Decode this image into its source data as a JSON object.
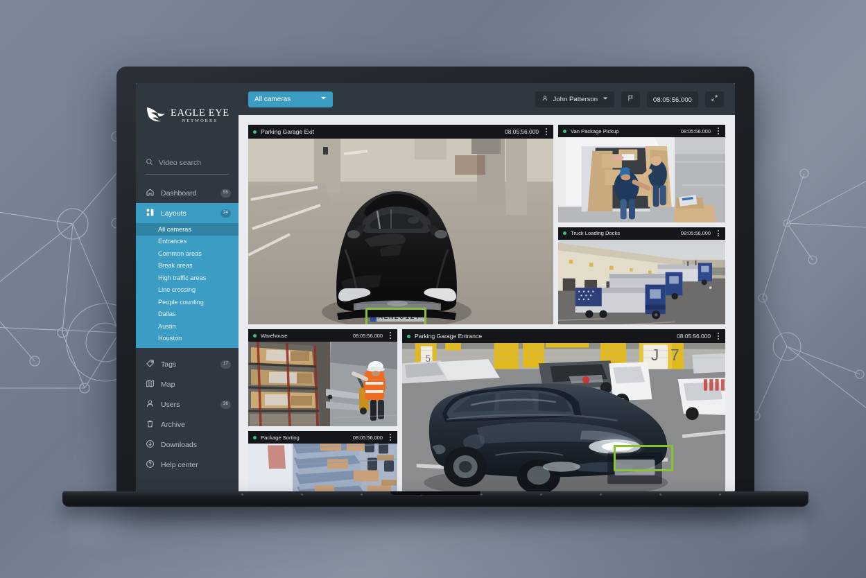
{
  "brand": {
    "name_line1": "EAGLE EYE",
    "name_line2": "NETWORKS",
    "accent": "#3b9cc4",
    "sidebar_bg": "#2f3741",
    "detection_box_color": "#86c232",
    "status_dot_color": "#3fc07f"
  },
  "sidebar": {
    "search": {
      "placeholder": "Video search",
      "value": "",
      "icon": "search-icon"
    },
    "items": [
      {
        "label": "Dashboard",
        "badge": "55",
        "icon": "home-icon",
        "active": false
      },
      {
        "label": "Layouts",
        "badge": "24",
        "icon": "layouts-grid-icon",
        "active": true
      },
      {
        "label": "Tags",
        "badge": "17",
        "icon": "tag-icon",
        "active": false
      },
      {
        "label": "Map",
        "badge": "",
        "icon": "map-icon",
        "active": false
      },
      {
        "label": "Users",
        "badge": "36",
        "icon": "user-icon",
        "active": false
      },
      {
        "label": "Archive",
        "badge": "",
        "icon": "trash-icon",
        "active": false
      },
      {
        "label": "Downloads",
        "badge": "",
        "icon": "download-circle-icon",
        "active": false
      },
      {
        "label": "Help center",
        "badge": "",
        "icon": "help-circle-icon",
        "active": false
      }
    ],
    "layouts_submenu": [
      {
        "label": "All cameras",
        "selected": true
      },
      {
        "label": "Entrances",
        "selected": false
      },
      {
        "label": "Common areas",
        "selected": false
      },
      {
        "label": "Break areas",
        "selected": false
      },
      {
        "label": "High traffic areas",
        "selected": false
      },
      {
        "label": "Line crossing",
        "selected": false
      },
      {
        "label": "People counting",
        "selected": false
      },
      {
        "label": "Dallas",
        "selected": false
      },
      {
        "label": "Austin",
        "selected": false
      },
      {
        "label": "Houston",
        "selected": false
      }
    ]
  },
  "topbar": {
    "camera_filter": {
      "label": "All cameras",
      "icon": "chevron-down-icon"
    },
    "user": {
      "label": "John Patterson",
      "icon": "user-icon",
      "chevron": "chevron-down-icon"
    },
    "flag_button": {
      "icon": "flag-icon"
    },
    "timestamp": "08:05:56.000",
    "fullscreen_button": {
      "icon": "expand-arrows-icon"
    }
  },
  "tiles": [
    {
      "title": "Parking Garage Exit",
      "time": "08:05:56.000",
      "status": "online",
      "scene": "garage-exit"
    },
    {
      "title": "Van Package Pickup",
      "time": "08:05:56.000",
      "status": "online",
      "scene": "van"
    },
    {
      "title": "Truck Loading Docks",
      "time": "08:05:56.000",
      "status": "online",
      "scene": "trucks"
    },
    {
      "title": "Warehouse",
      "time": "08:05:56.000",
      "status": "online",
      "scene": "warehouse"
    },
    {
      "title": "Package Sorting",
      "time": "08:05:56.000",
      "status": "online",
      "scene": "sorting"
    },
    {
      "title": "Parking Garage Entrance",
      "time": "08:05:56.000",
      "status": "online",
      "scene": "garage-entrance"
    }
  ],
  "detections": {
    "exit_plate_text": "ALN2012T",
    "entrance_plate_text": ""
  },
  "garage_signs": {
    "pillar_j": "J",
    "pillar_7": "7",
    "pillar_5": "5"
  }
}
